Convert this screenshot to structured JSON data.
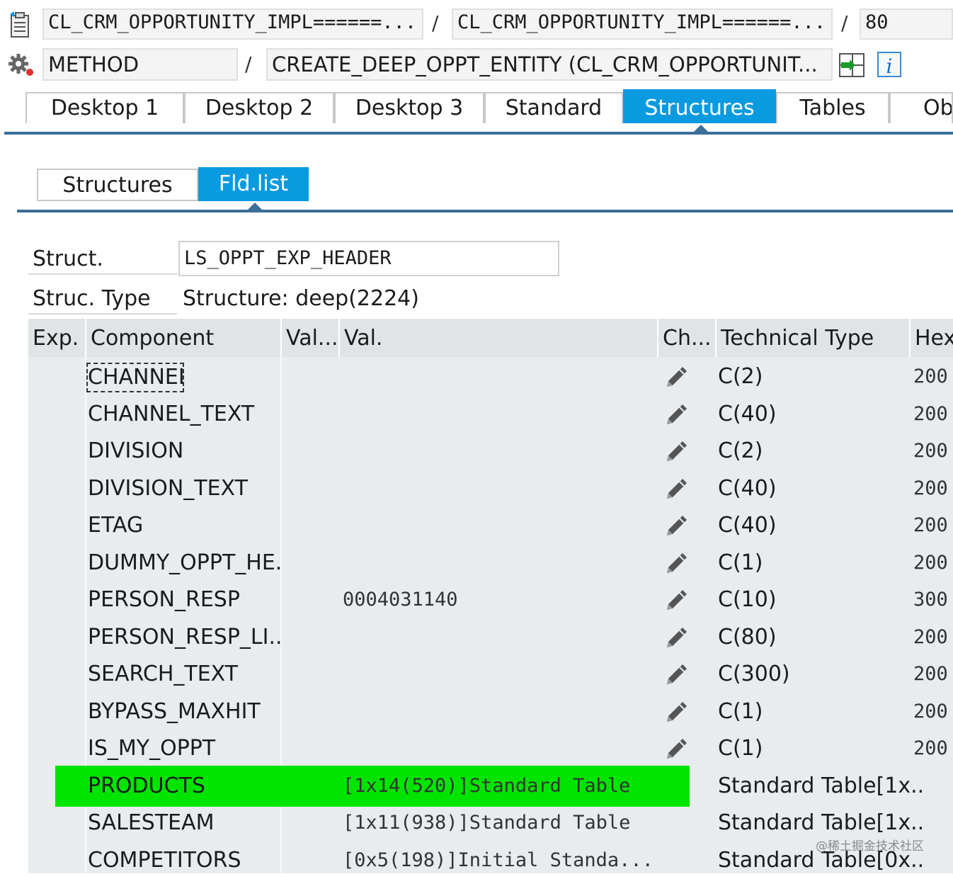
{
  "header": {
    "row1": {
      "class_field_1": "CL_CRM_OPPORTUNITY_IMPL======...",
      "class_field_2": "CL_CRM_OPPORTUNITY_IMPL======...",
      "line_number": "80",
      "separator": "/"
    },
    "row2": {
      "type_field": "METHOD",
      "method_field": "CREATE_DEEP_OPPT_ENTITY (CL_CRM_OPPORTUNIT...",
      "separator": "/"
    }
  },
  "tabs": [
    {
      "label": "Desktop 1"
    },
    {
      "label": "Desktop 2"
    },
    {
      "label": "Desktop 3"
    },
    {
      "label": "Standard"
    },
    {
      "label": "Structures"
    },
    {
      "label": "Tables"
    },
    {
      "label": "Obj"
    }
  ],
  "subtabs": [
    {
      "label": "Structures"
    },
    {
      "label": "Fld.list"
    }
  ],
  "form": {
    "struct_label": "Struct.",
    "struct_value": "LS_OPPT_EXP_HEADER",
    "type_label": "Struc. Type",
    "type_value": "Structure: deep(2224)"
  },
  "table": {
    "columns": [
      "Exp.",
      "Component",
      "Val...",
      "Val.",
      "Ch...",
      "Technical Type",
      "Hex"
    ],
    "rows": [
      {
        "component": "CHANNEL",
        "val": "",
        "tech": "C(2)",
        "hex": "200"
      },
      {
        "component": "CHANNEL_TEXT",
        "val": "",
        "tech": "C(40)",
        "hex": "200"
      },
      {
        "component": "DIVISION",
        "val": "",
        "tech": "C(2)",
        "hex": "200"
      },
      {
        "component": "DIVISION_TEXT",
        "val": "",
        "tech": "C(40)",
        "hex": "200"
      },
      {
        "component": "ETAG",
        "val": "",
        "tech": "C(40)",
        "hex": "200"
      },
      {
        "component": "DUMMY_OPPT_HE..",
        "val": "",
        "tech": "C(1)",
        "hex": "200"
      },
      {
        "component": "PERSON_RESP",
        "val": "0004031140",
        "tech": "C(10)",
        "hex": "300"
      },
      {
        "component": "PERSON_RESP_LI...",
        "val": "",
        "tech": "C(80)",
        "hex": "200"
      },
      {
        "component": "SEARCH_TEXT",
        "val": "",
        "tech": "C(300)",
        "hex": "200"
      },
      {
        "component": "BYPASS_MAXHIT",
        "val": "",
        "tech": "C(1)",
        "hex": "200"
      },
      {
        "component": "IS_MY_OPPT",
        "val": "",
        "tech": "C(1)",
        "hex": "200"
      },
      {
        "component": "PRODUCTS",
        "val": "[1x14(520)]Standard Table",
        "tech": "Standard Table[1x...",
        "hex": ""
      },
      {
        "component": "SALESTEAM",
        "val": "[1x11(938)]Standard Table",
        "tech": "Standard Table[1x...",
        "hex": ""
      },
      {
        "component": "COMPETITORS",
        "val": "[0x5(198)]Initial Standa...",
        "tech": "Standard Table[0x...",
        "hex": ""
      }
    ]
  },
  "watermark": "@稀土掘金技术社区",
  "colors": {
    "accent": "#0a9adf",
    "highlight": "#00e400",
    "grid_bg": "#e8ecef"
  },
  "icons": [
    "program-icon",
    "settings-gear-icon",
    "navigate-icon",
    "info-icon",
    "pencil-icon"
  ]
}
